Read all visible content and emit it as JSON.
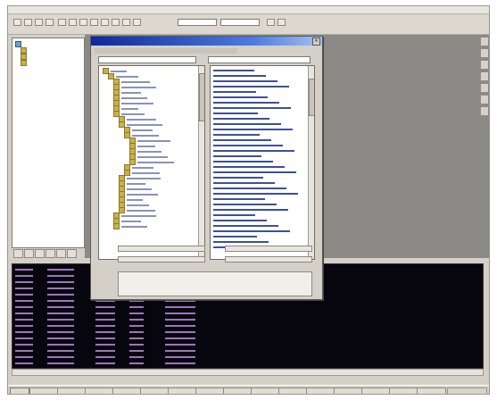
{
  "window": {
    "title": "",
    "toolbar": {
      "combo1": "",
      "combo2": ""
    }
  },
  "left_tree": {
    "items": [
      {
        "label": "",
        "indent": 0,
        "icon": "computer"
      },
      {
        "label": "",
        "indent": 1,
        "icon": "folder"
      },
      {
        "label": "",
        "indent": 1,
        "icon": "folder"
      },
      {
        "label": "",
        "indent": 1,
        "icon": "folder"
      }
    ]
  },
  "dialog": {
    "title": "",
    "close_glyph": "×",
    "path_field": "",
    "filter_field": "",
    "tree_rows": 30,
    "list_rows": 34,
    "fields": {
      "name_label": "",
      "name_value": "",
      "type_label": "",
      "type_value": "",
      "file_label": "",
      "file_value": "",
      "size_label": "",
      "size_value": "",
      "description": ""
    }
  },
  "console": {
    "lines": 16
  },
  "taskbar": {
    "start_label": "",
    "items": [
      "",
      "",
      "",
      "",
      "",
      "",
      "",
      "",
      "",
      "",
      "",
      "",
      "",
      "",
      ""
    ],
    "clock": ""
  },
  "colors": {
    "accent_titlebar": "#0d2a9a",
    "console_bg": "#07060e",
    "console_text": "#b48ad0",
    "list_text": "#1c2d86"
  },
  "icons": [
    "folder-icon",
    "computer-icon",
    "close-icon",
    "tree-expand-icon"
  ]
}
